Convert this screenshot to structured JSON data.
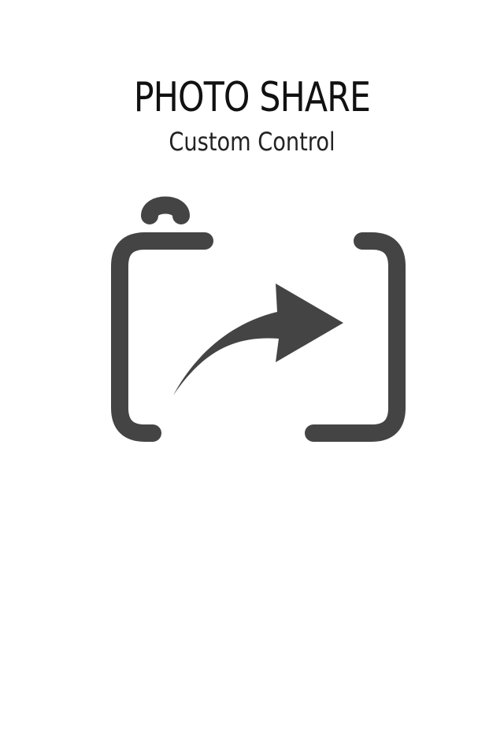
{
  "app": {
    "title": "PHOTO SHARE",
    "subtitle": "Custom Control"
  },
  "logo": {
    "icon": "camera-share-icon",
    "color": "#444444"
  }
}
